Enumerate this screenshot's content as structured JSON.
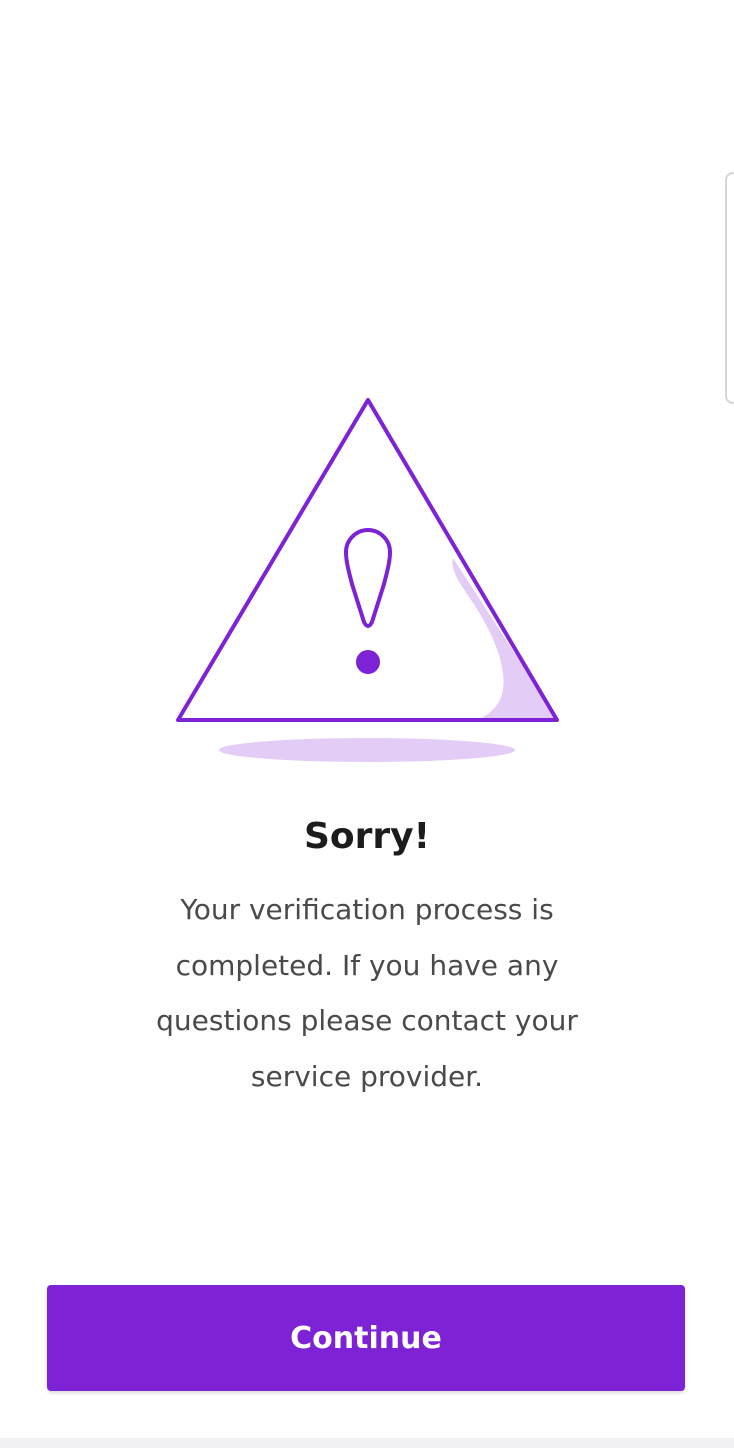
{
  "colors": {
    "accent": "#7d22d4",
    "accent_light": "#e3cdf6",
    "title": "#1c1c1c",
    "body_text": "#4a4a4a",
    "background": "#ffffff"
  },
  "illustration": {
    "icon": "warning-triangle-icon"
  },
  "content": {
    "title": "Sorry!",
    "message": "Your verification process is completed. If you have any questions please contact your service provider."
  },
  "actions": {
    "continue_label": "Continue"
  }
}
